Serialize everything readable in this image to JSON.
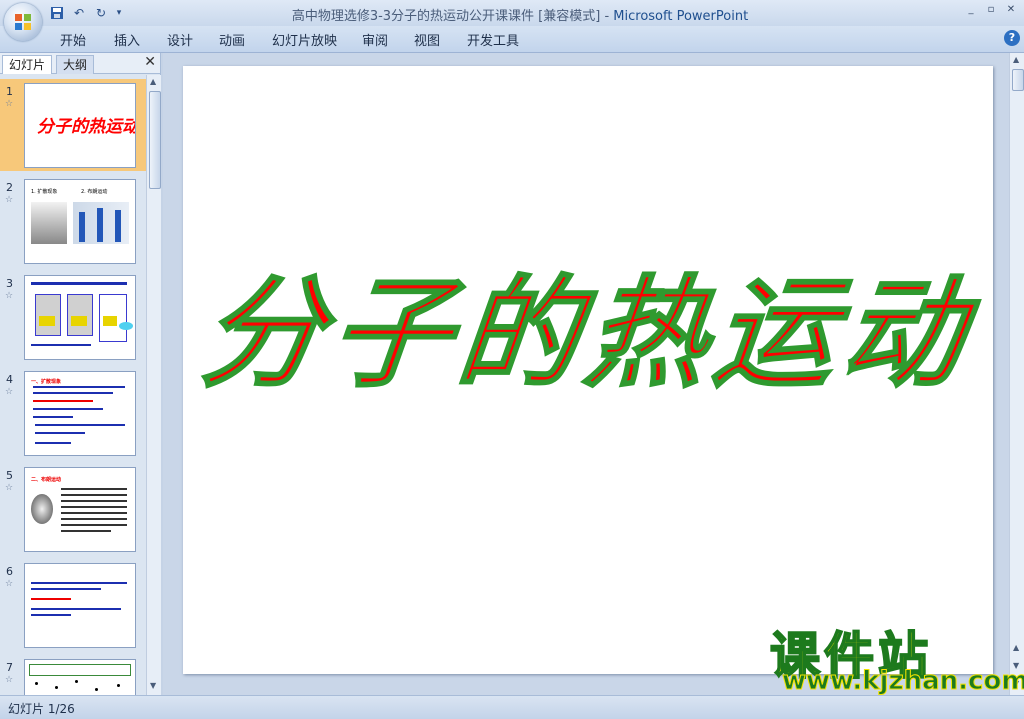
{
  "window": {
    "title": "高中物理选修3-3分子的热运动公开课课件 [兼容模式]",
    "title_sep": " - ",
    "app_name": "Microsoft PowerPoint",
    "controls": [
      "_",
      "▫",
      "✕"
    ]
  },
  "qat": {
    "save": "💾",
    "undo": "↶",
    "redo": "↻",
    "more": "▾"
  },
  "ribbon": {
    "tabs": [
      "开始",
      "插入",
      "设计",
      "动画",
      "幻灯片放映",
      "审阅",
      "视图",
      "开发工具"
    ],
    "help": "?"
  },
  "pane": {
    "tabs": [
      "幻灯片",
      "大纲"
    ],
    "close": "✕"
  },
  "thumbnails": [
    {
      "num": "1",
      "title": "分子的热运动"
    },
    {
      "num": "2",
      "caption1": "1. 扩散现象",
      "caption2": "2. 布朗运动"
    },
    {
      "num": "3"
    },
    {
      "num": "4",
      "heading": "一、扩散现象"
    },
    {
      "num": "5",
      "heading": "二、布朗运动"
    },
    {
      "num": "6"
    },
    {
      "num": "7"
    }
  ],
  "slide": {
    "title": "分子的热运动"
  },
  "watermark": {
    "cn": "课件站",
    "url": "www.kjzhan.com"
  },
  "status": {
    "slide_counter": "幻灯片 1/26"
  },
  "colors": {
    "title_red": "#ff0000",
    "title_outline": "#2f9a2f",
    "selection": "#f7c87a",
    "app_blue": "#1f4f8f"
  }
}
